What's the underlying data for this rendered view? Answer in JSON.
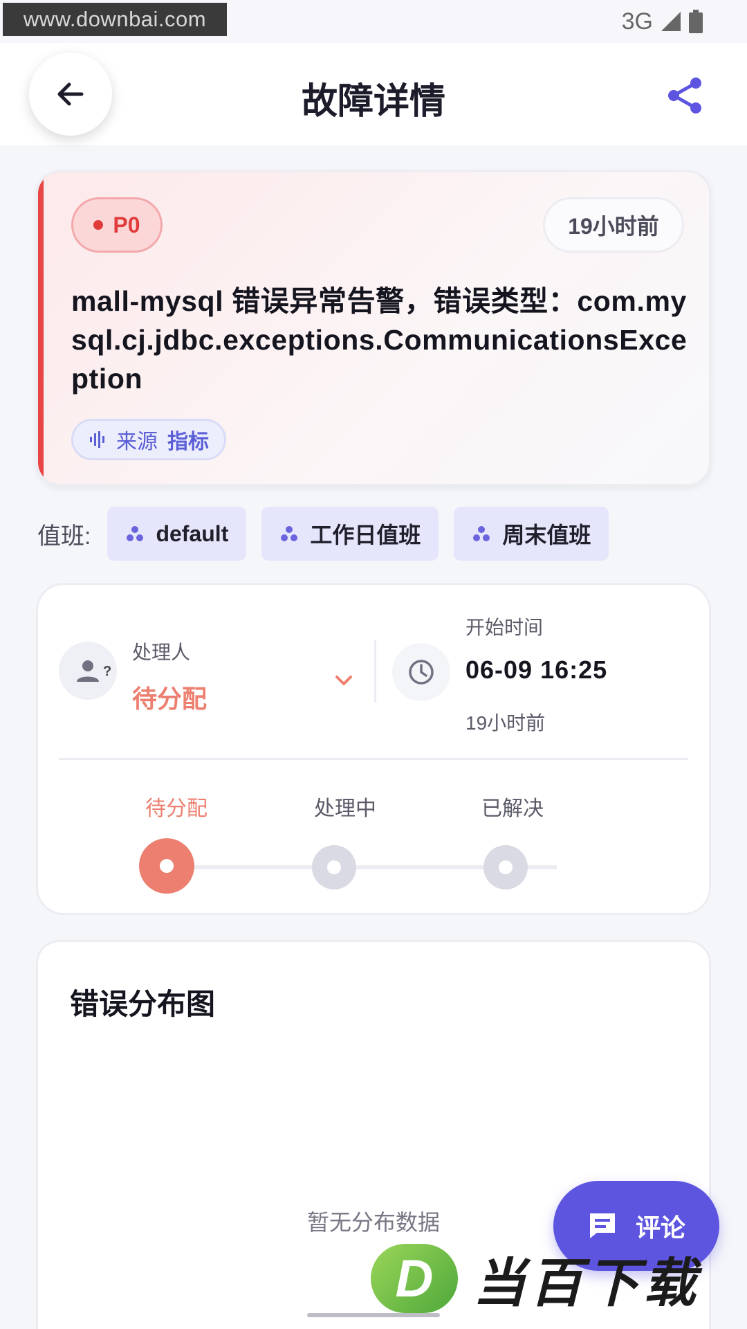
{
  "status_bar": {
    "watermark": "www.downbai.com",
    "network": "3G"
  },
  "header": {
    "title": "故障详情",
    "back_icon": "arrow-left-icon",
    "share_icon": "share-icon"
  },
  "alert": {
    "priority": "P0",
    "time_ago": "19小时前",
    "title": "mall-mysql 错误异常告警，错误类型：com.mysql.cj.jdbc.exceptions.CommunicationsException",
    "source_label": "来源",
    "source_value": "指标",
    "accent_color": "#e84545"
  },
  "duty": {
    "label": "值班:",
    "chips": [
      {
        "label": "default"
      },
      {
        "label": "工作日值班"
      },
      {
        "label": "周末值班"
      }
    ]
  },
  "handler": {
    "handler_label": "处理人",
    "handler_value": "待分配",
    "start_label": "开始时间",
    "start_value": "06-09 16:25",
    "start_ago": "19小时前",
    "steps": [
      {
        "label": "待分配",
        "active": true
      },
      {
        "label": "处理中",
        "active": false
      },
      {
        "label": "已解决",
        "active": false
      }
    ],
    "active_color": "#ec7f6f"
  },
  "distribution": {
    "title": "错误分布图",
    "empty_text": "暂无分布数据"
  },
  "fab": {
    "label": "评论",
    "icon": "comment-icon"
  },
  "watermark_bottom": {
    "letter": "D",
    "text": "当百下载"
  }
}
